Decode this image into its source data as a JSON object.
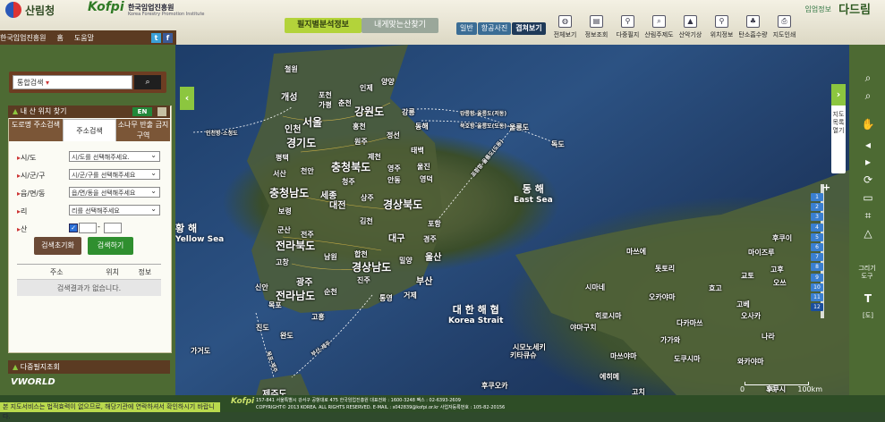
{
  "header": {
    "agency_name": "산림청",
    "institute_logo": "Kofpi",
    "institute_name": "한국임업진흥원",
    "institute_name_en": "Korea Forestry Promotion Institute",
    "brand_small": "임업정보",
    "brand_large": "다드림",
    "nav_tabs": [
      {
        "label": "필지별분석정보",
        "active": true
      },
      {
        "label": "내게맞는산찾기",
        "active": false
      }
    ],
    "map_types": [
      {
        "label": "일반",
        "active": false
      },
      {
        "label": "항공사진",
        "active": false
      },
      {
        "label": "겹쳐보기",
        "active": true
      }
    ],
    "tools": [
      {
        "label": "전체보기",
        "icon": "globe-icon"
      },
      {
        "label": "정보조회",
        "icon": "info-icon"
      },
      {
        "label": "다중필지",
        "icon": "pin-plus-icon"
      },
      {
        "label": "산림주제도",
        "icon": "search-map-icon"
      },
      {
        "label": "산악기상",
        "icon": "mountain-icon"
      },
      {
        "label": "위치정보",
        "icon": "location-icon"
      },
      {
        "label": "탄소흡수량",
        "icon": "tree-icon"
      },
      {
        "label": "지도인쇄",
        "icon": "print-icon"
      }
    ]
  },
  "linkbar": {
    "items": [
      "한국임업진흥원",
      "홈",
      "도움말"
    ],
    "social": [
      "t",
      "f"
    ]
  },
  "search": {
    "value": "통합검색",
    "button": "🔍"
  },
  "find_panel": {
    "title": "내 산 위치 찾기",
    "lang": "EN",
    "tabs": [
      {
        "label": "도로명 주소검색",
        "active": false
      },
      {
        "label": "주소검색",
        "active": true
      },
      {
        "label": "소나무 반출 금지구역",
        "active": false
      }
    ],
    "fields": [
      {
        "label": "시/도",
        "value": "시/도를 선택해주세요."
      },
      {
        "label": "시/군/구",
        "value": "시/군/구를 선택해주세요"
      },
      {
        "label": "읍/면/동",
        "value": "읍/면/동을 선택해주세요"
      },
      {
        "label": "리",
        "value": "리를 선택해주세요"
      }
    ],
    "mountain_label": "산",
    "lot_separator": "-",
    "reset_button": "검색초기화",
    "search_button": "검색하기",
    "result_columns": [
      "주소",
      "위치",
      "정보"
    ],
    "empty_result": "검색결과가 없습니다."
  },
  "multi_panel": {
    "title": "다중필지조회"
  },
  "vworld_logo": "VWORLD",
  "right_tools": {
    "zoom_in_icon": "magnifier-plus-icon",
    "zoom_out_icon": "magnifier-minus-icon",
    "drawing_label": "그리기 도구",
    "text_tool": "T",
    "coord_tool": "[도]"
  },
  "layer_tab_label": "지도목록 열기",
  "map": {
    "places_large": [
      "강원도",
      "서울",
      "인천",
      "경기도",
      "충청북도",
      "충청남도",
      "세종",
      "대전",
      "경상북도",
      "전라북도",
      "대구",
      "경상남도",
      "울산",
      "광주",
      "부산",
      "전라남도"
    ],
    "places_small": [
      "철원",
      "인제",
      "개성",
      "포천",
      "가평",
      "춘천",
      "양양",
      "강릉",
      "홍천",
      "동해",
      "원주",
      "정선",
      "평택",
      "제천",
      "태백",
      "천안",
      "영주",
      "울진",
      "서산",
      "청주",
      "안동",
      "영덕",
      "상주",
      "보령",
      "김천",
      "포항",
      "군산",
      "전주",
      "경주",
      "합천",
      "밀양",
      "고창",
      "남원",
      "진주",
      "목포",
      "순천",
      "통영",
      "신안",
      "진도",
      "고흥",
      "완도",
      "거제",
      "가거도",
      "울릉도",
      "독도",
      "제주도"
    ],
    "routes": [
      "인천항-소청도",
      "강릉항-울릉도(저동)",
      "묵호항-울릉도(도동)",
      "포항항-울릉도(도동)",
      "목포-제주",
      "부산-제주"
    ],
    "japan_places": [
      "후쿠이",
      "마쓰에",
      "돗토리",
      "마이즈루",
      "시마네",
      "오카야마",
      "교토",
      "오쓰",
      "효고",
      "고베",
      "나라",
      "고후",
      "히로시마",
      "다카마쓰",
      "오사카",
      "야마구치",
      "가가와",
      "도쿠시마",
      "에히메",
      "고치",
      "시모노세키",
      "키타큐슈",
      "마쓰야마",
      "와카야마",
      "후쿠오카",
      "후쿠시"
    ],
    "seas": [
      {
        "ko": "동 해",
        "en": "East Sea"
      },
      {
        "ko": "대 한 해 협",
        "en": "Korea Strait"
      },
      {
        "ko": "황 해",
        "en": "Yellow Sea"
      }
    ],
    "scale_labels": [
      "0",
      "50",
      "100km"
    ],
    "zoom_levels": [
      "1",
      "2",
      "3",
      "4",
      "5",
      "6",
      "7",
      "8",
      "9",
      "10",
      "11",
      "12"
    ],
    "current_level": "12"
  },
  "footer": {
    "notice": "본 지도서비스는 법적효력이 없으므로, 해당기관에 연락하셔서 확인하시기 바랍니다.",
    "address": "157-841 서울특별시 강서구 공항대로 475 한국임업진흥원 대표전화 : 1600-3248 팩스 : 02-6393-2609",
    "copyright": "COPYRIGHT© 2013 KOREA. ALL RIGHTS RESERVED. E-MAIL : s042839@kofpi.or.kr 사업자등록번호 : 105-82-20156"
  },
  "colors": {
    "accent_green": "#8cc63f",
    "brown": "#5b3b22",
    "frame_green": "#4d6a33",
    "search_button_green": "#2f8f2f"
  }
}
